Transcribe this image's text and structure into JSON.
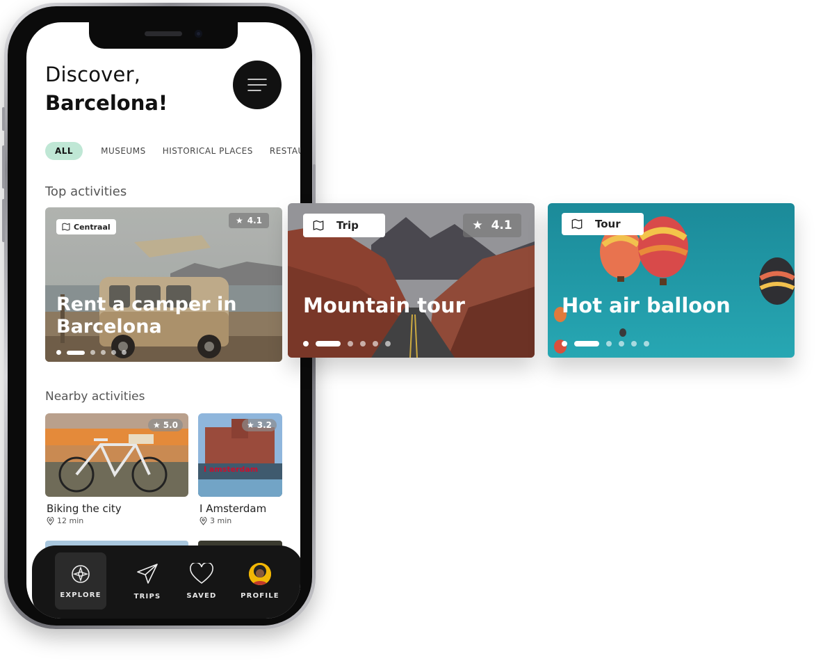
{
  "header": {
    "line1": "Discover,",
    "line2": "Barcelona!"
  },
  "categories": [
    "ALL",
    "MUSEUMS",
    "HISTORICAL PLACES",
    "RESTAURA"
  ],
  "sections": {
    "top": "Top activities",
    "nearby": "Nearby activities"
  },
  "top_card": {
    "tag": "Centraal",
    "rating": "4.1",
    "title": "Rent a camper in Barcelona"
  },
  "float_cards": [
    {
      "tag": "Trip",
      "rating": "4.1",
      "title": "Mountain tour"
    },
    {
      "tag": "Tour",
      "title": "Hot air balloon"
    }
  ],
  "nearby": [
    {
      "name": "Biking the city",
      "time": "12 min",
      "rating": "5.0"
    },
    {
      "name": "I Amsterdam",
      "time": "3 min",
      "rating": "3.2",
      "sign": "I amsterdam"
    }
  ],
  "nav": [
    {
      "label": "EXPLORE",
      "icon": "compass-icon"
    },
    {
      "label": "TRIPS",
      "icon": "paper-plane-icon"
    },
    {
      "label": "SAVED",
      "icon": "heart-icon"
    },
    {
      "label": "PROFILE",
      "icon": "avatar"
    }
  ],
  "colors": {
    "accent_chip": "#bfe7d5",
    "nav_bg": "#151515",
    "teal_card": "#1e9aa8"
  }
}
